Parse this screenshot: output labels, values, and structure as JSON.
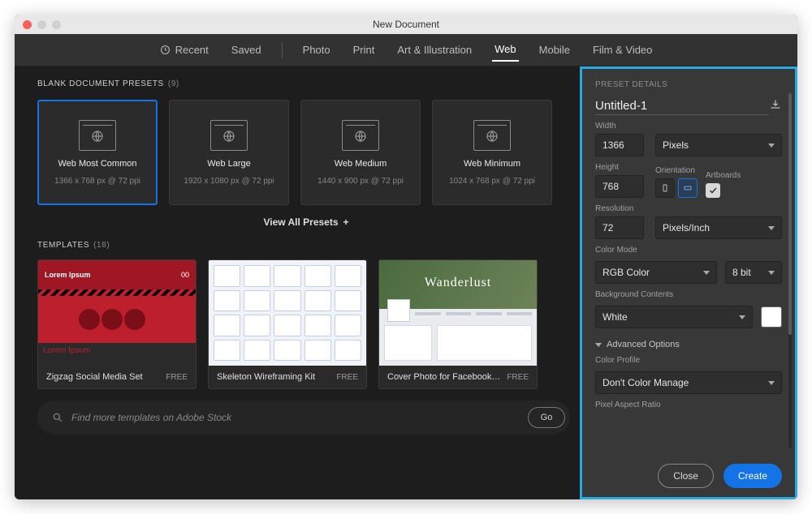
{
  "window": {
    "title": "New Document"
  },
  "tabs": {
    "recent": "Recent",
    "saved": "Saved",
    "photo": "Photo",
    "print": "Print",
    "art": "Art & Illustration",
    "web": "Web",
    "mobile": "Mobile",
    "film": "Film & Video"
  },
  "presets": {
    "heading": "BLANK DOCUMENT PRESETS",
    "count": "(9)",
    "items": [
      {
        "name": "Web Most Common",
        "dim": "1366 x 768 px @ 72 ppi"
      },
      {
        "name": "Web Large",
        "dim": "1920 x 1080 px @ 72 ppi"
      },
      {
        "name": "Web Medium",
        "dim": "1440 x 900 px @ 72 ppi"
      },
      {
        "name": "Web Minimum",
        "dim": "1024 x 768 px @ 72 ppi"
      }
    ],
    "view_all": "View All Presets"
  },
  "templates": {
    "heading": "TEMPLATES",
    "count": "(18)",
    "items": [
      {
        "name": "Zigzag Social Media Set",
        "price": "FREE",
        "lorem": "Lorem Ipsum",
        "lorem2": "Lorem Ipsum",
        "badge": "00"
      },
      {
        "name": "Skeleton Wireframing Kit",
        "price": "FREE"
      },
      {
        "name": "Cover Photo for Facebook with In…",
        "price": "FREE",
        "overlay": "Wanderlust"
      }
    ]
  },
  "search": {
    "placeholder": "Find more templates on Adobe Stock",
    "go": "Go"
  },
  "details": {
    "heading": "PRESET DETAILS",
    "docname": "Untitled-1",
    "width_label": "Width",
    "width": "1366",
    "width_unit": "Pixels",
    "height_label": "Height",
    "height": "768",
    "orientation_label": "Orientation",
    "artboards_label": "Artboards",
    "artboards_checked": true,
    "resolution_label": "Resolution",
    "resolution": "72",
    "resolution_unit": "Pixels/Inch",
    "colormode_label": "Color Mode",
    "colormode": "RGB Color",
    "bitdepth": "8 bit",
    "bg_label": "Background Contents",
    "bg": "White",
    "advanced": "Advanced Options",
    "profile_label": "Color Profile",
    "profile": "Don't Color Manage",
    "par_label": "Pixel Aspect Ratio"
  },
  "buttons": {
    "close": "Close",
    "create": "Create"
  }
}
